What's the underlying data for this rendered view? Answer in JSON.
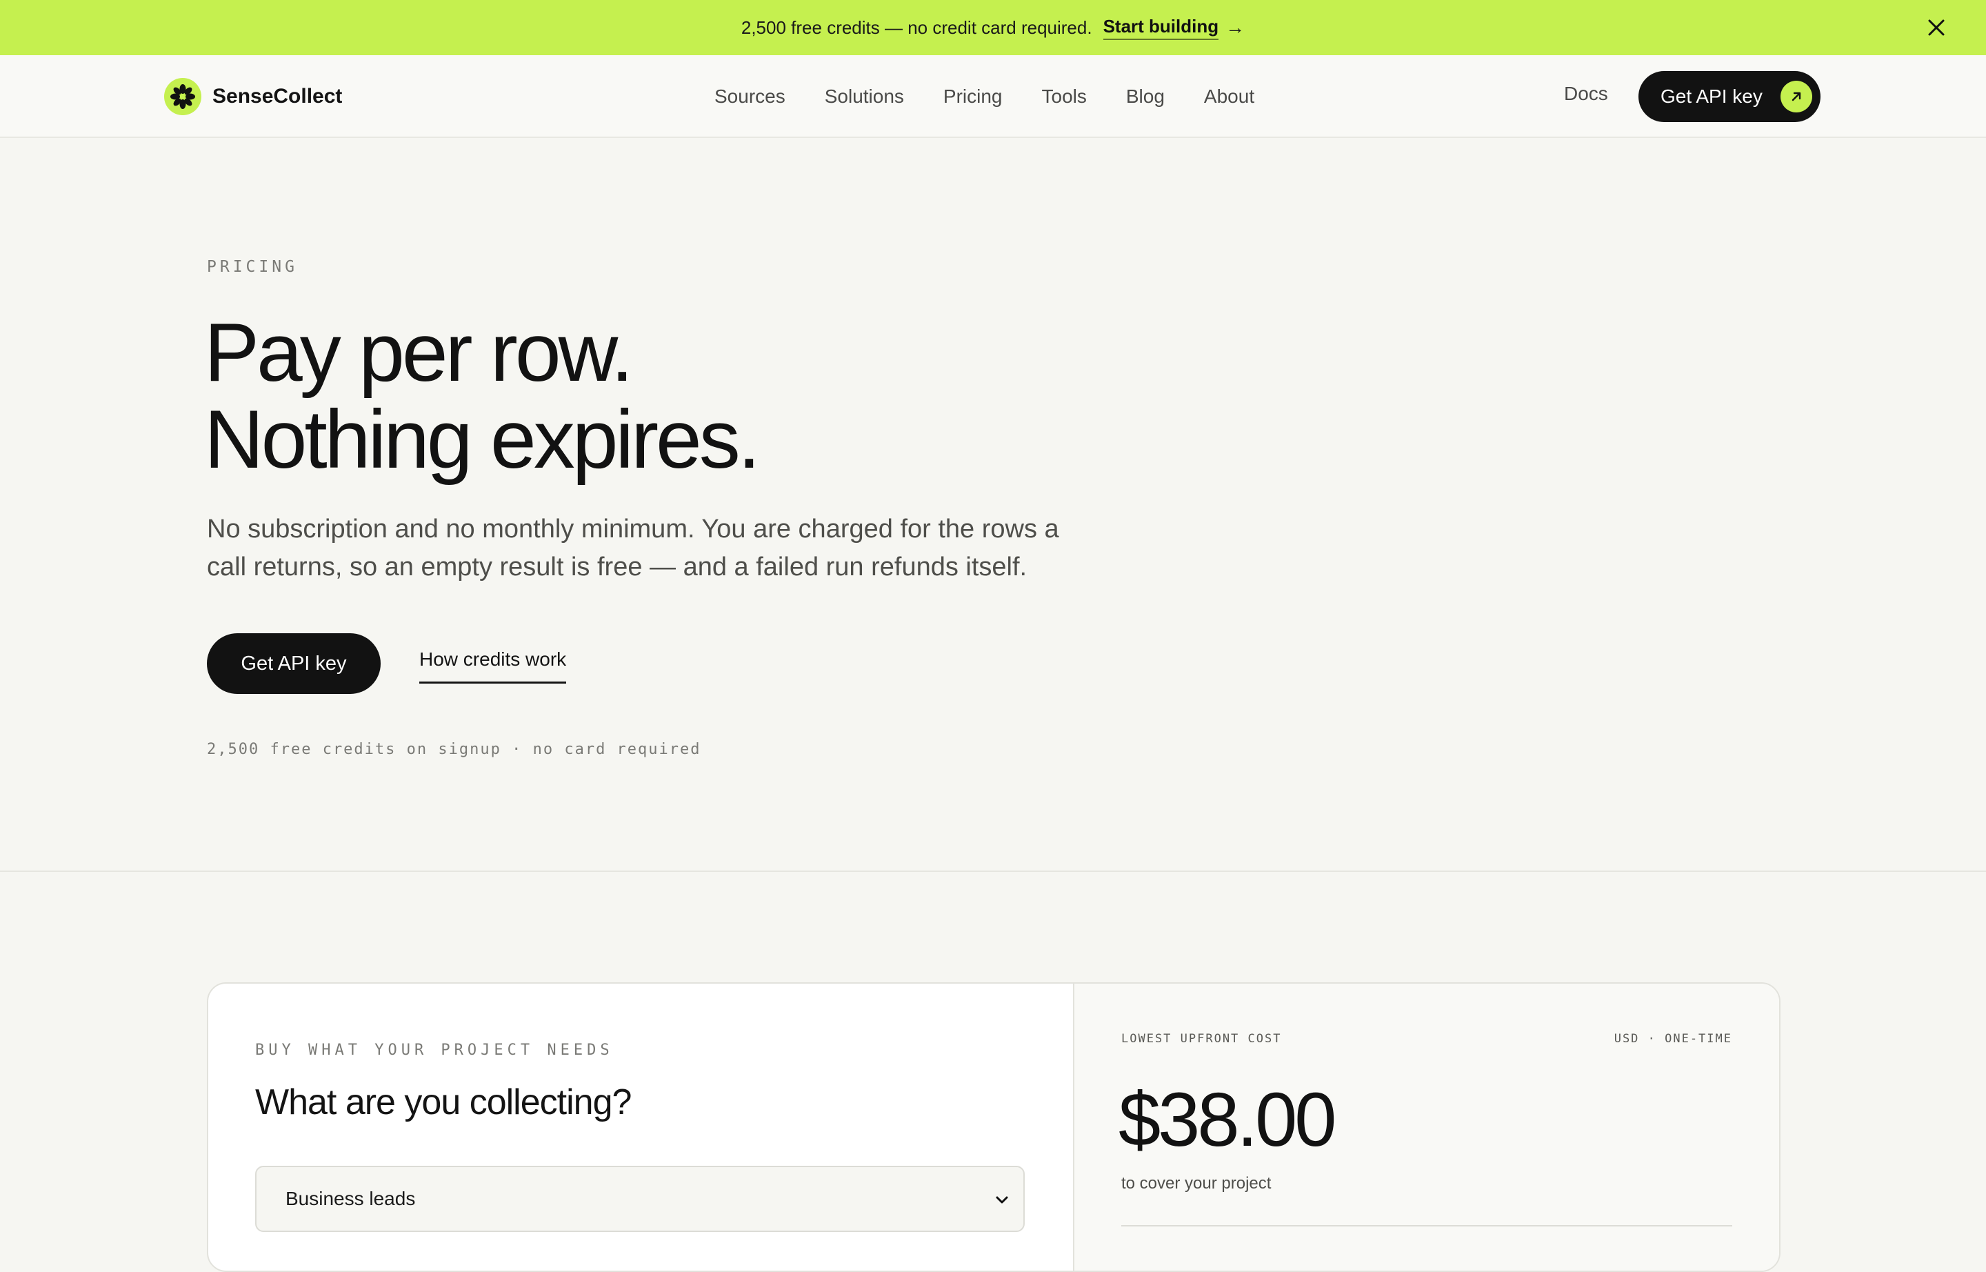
{
  "banner": {
    "text": "2,500 free credits — no credit card required.",
    "cta": "Start building",
    "arrow": "→"
  },
  "brand": {
    "name": "SenseCollect",
    "accent": "#c5f04f"
  },
  "nav": {
    "items": [
      "Sources",
      "Solutions",
      "Pricing",
      "Tools",
      "Blog",
      "About"
    ],
    "docs": "Docs",
    "cta": "Get API key"
  },
  "hero": {
    "eyebrow": "PRICING",
    "headline_line1": "Pay per row.",
    "headline_line2": "Nothing expires.",
    "lead": "No subscription and no monthly minimum. You are charged for the rows a call returns, so an empty result is free — and a failed run refunds itself.",
    "primary_cta": "Get API key",
    "secondary_cta": "How credits work",
    "fineprint": "2,500 free credits on signup · no card required"
  },
  "calculator": {
    "eyebrow": "BUY WHAT YOUR PROJECT NEEDS",
    "title": "What are you collecting?",
    "selected": "Business leads",
    "summary_label": "LOWEST UPFRONT COST",
    "summary_meta": "USD · ONE-TIME",
    "price": "$38.00",
    "price_sub": "to cover your project"
  }
}
